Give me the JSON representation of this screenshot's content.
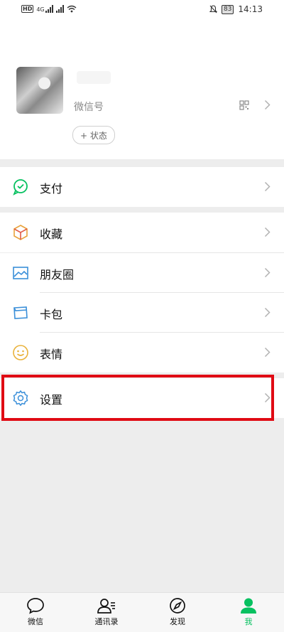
{
  "status_bar": {
    "network_badge": "HD",
    "signal_label": "4G",
    "battery": "83",
    "time": "14:13"
  },
  "profile": {
    "wechat_id_label": "微信号",
    "status_button_label": "+ 状态"
  },
  "menu": {
    "pay": "支付",
    "favorites": "收藏",
    "moments": "朋友圈",
    "cards": "卡包",
    "stickers": "表情",
    "settings": "设置"
  },
  "tabs": [
    {
      "label": "微信",
      "icon": "chat-bubble-icon",
      "active": false
    },
    {
      "label": "通讯录",
      "icon": "contacts-icon",
      "active": false
    },
    {
      "label": "发现",
      "icon": "compass-icon",
      "active": false
    },
    {
      "label": "我",
      "icon": "person-icon",
      "active": true
    }
  ],
  "colors": {
    "accent": "#07c160",
    "highlight_border": "#e00b14",
    "background": "#ededed"
  }
}
